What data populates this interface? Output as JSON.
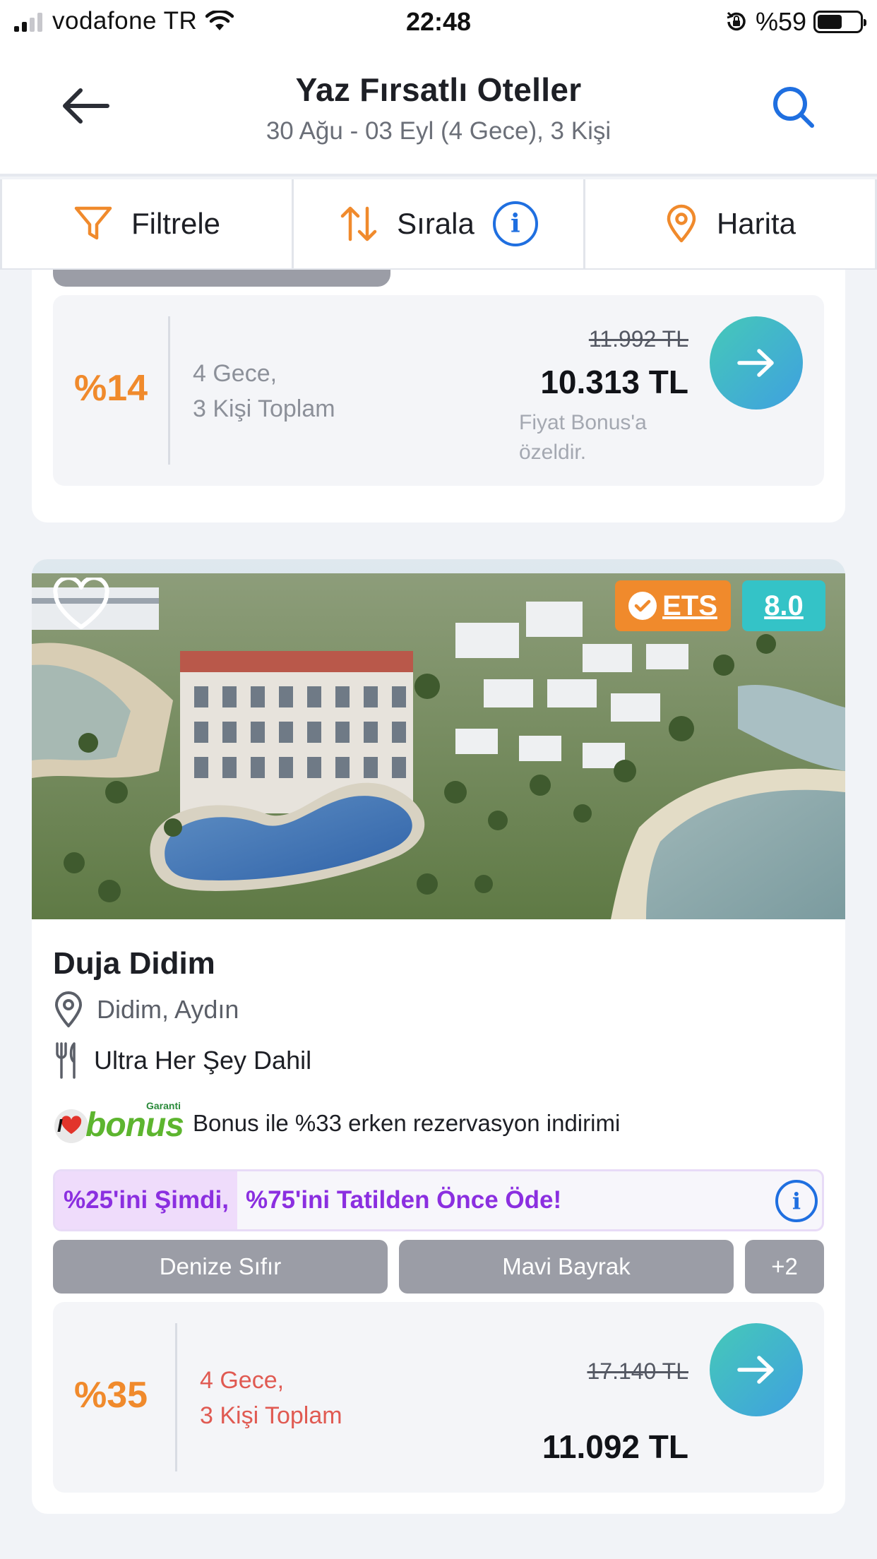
{
  "status_bar": {
    "carrier": "vodafone TR",
    "time": "22:48",
    "battery_text": "%59",
    "battery_level": 0.59
  },
  "header": {
    "title": "Yaz Fırsatlı Oteller",
    "subtitle": "30 Ağu - 03 Eyl (4 Gece), 3 Kişi"
  },
  "filter_bar": {
    "filter_label": "Filtrele",
    "sort_label": "Sırala",
    "sort_info": "i",
    "map_label": "Harita"
  },
  "hotels": [
    {
      "price": {
        "discount": "%14",
        "nights_line1": "4 Gece,",
        "nights_line2": "3 Kişi Toplam",
        "old_price": "11.992 TL",
        "new_price": "10.313 TL",
        "note_line1": "Fiyat Bonus'a",
        "note_line2": "özeldir."
      }
    },
    {
      "name": "Duja Didim",
      "location": "Didim, Aydın",
      "board": "Ultra Her Şey Dahil",
      "ets_label": "ETS",
      "score": "8.0",
      "bonus": {
        "logo_small": "Garanti",
        "logo_main": "bonus",
        "logo_i": "I",
        "text": "Bonus ile %33 erken rezervasyon indirimi"
      },
      "payment": {
        "now": "%25'ini Şimdi,",
        "later": "%75'ini Tatilden Önce Öde!",
        "info": "i"
      },
      "tags": [
        "Denize Sıfır",
        "Mavi Bayrak",
        "+2"
      ],
      "price": {
        "discount": "%35",
        "nights_line1": "4 Gece,",
        "nights_line2": "3 Kişi Toplam",
        "old_price": "17.140 TL",
        "new_price": "11.092 TL"
      }
    }
  ],
  "colors": {
    "accent_orange": "#f08a2c",
    "accent_blue": "#1f6fe0",
    "score_teal": "#34c3c7",
    "purple": "#8b2fe0",
    "tag_gray": "#9b9da6"
  }
}
